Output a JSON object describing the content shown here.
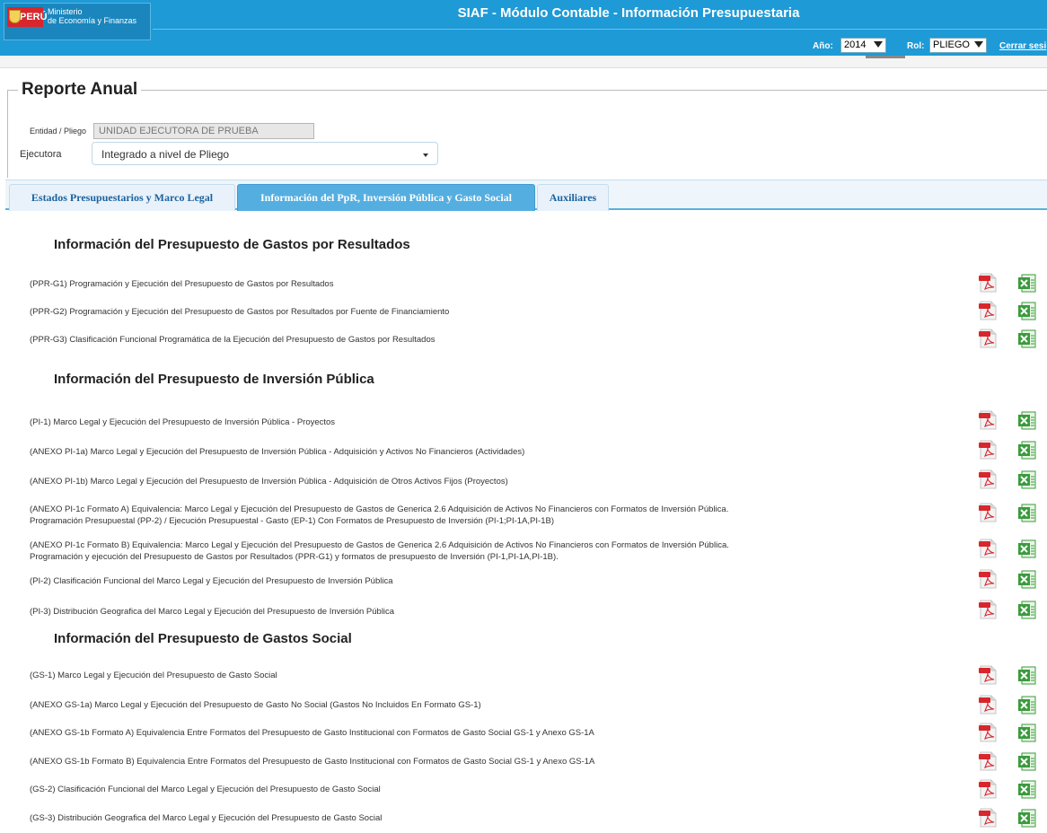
{
  "header": {
    "logo_country": "PERÚ",
    "logo_ministry_line1": "Ministerio",
    "logo_ministry_line2": "de Economía y Finanzas",
    "title": "SIAF - Módulo Contable - Información Presupuestaria",
    "year_label": "Año:",
    "year_value": "2014",
    "role_label": "Rol:",
    "role_value": "PLIEGO",
    "logout_label": "Cerrar sesi"
  },
  "report": {
    "title": "Reporte Anual",
    "entidad_label": "Entidad / Pliego",
    "entidad_value": "UNIDAD EJECUTORA DE PRUEBA",
    "ejecutora_label": "Ejecutora",
    "ejecutora_value": "Integrado a nivel de Pliego"
  },
  "tabs": [
    {
      "label": "Estados Presupuestarios y Marco Legal",
      "active": false
    },
    {
      "label": "Información del PpR, Inversión Pública y Gasto Social",
      "active": true
    },
    {
      "label": "Auxiliares",
      "active": false
    }
  ],
  "sections": [
    {
      "title": "Información del Presupuesto de Gastos por Resultados",
      "rows": [
        {
          "text": "(PPR-G1) Programación y Ejecución del Presupuesto de Gastos por Resultados"
        },
        {
          "text": "(PPR-G2) Programación y Ejecución del Presupuesto de Gastos por Resultados por Fuente de Financiamiento"
        },
        {
          "text": "(PPR-G3) Clasificación Funcional Programática de la Ejecución del Presupuesto de Gastos por Resultados"
        }
      ]
    },
    {
      "title": "Información del Presupuesto de Inversión Pública",
      "rows": [
        {
          "text": "(PI-1) Marco Legal y Ejecución del Presupuesto de Inversión Pública - Proyectos"
        },
        {
          "text": "(ANEXO PI-1a) Marco Legal y Ejecución del Presupuesto de Inversión Pública - Adquisición y Activos No Financieros (Actividades)"
        },
        {
          "text": "(ANEXO PI-1b) Marco Legal y Ejecución del Presupuesto de Inversión Pública - Adquisición de Otros Activos Fijos (Proyectos)"
        },
        {
          "text": "(ANEXO PI-1c Formato A) Equivalencia: Marco Legal y Ejecución del Presupuesto de Gastos de Generica 2.6 Adquisición de Activos No Financieros con Formatos de Inversión Pública.",
          "text2": "Programación Presupuestal (PP-2) / Ejecución Presupuestal - Gasto (EP-1) Con Formatos de Presupuesto de Inversión (PI-1;PI-1A,PI-1B)"
        },
        {
          "text": "(ANEXO PI-1c Formato B) Equivalencia: Marco Legal y Ejecución del Presupuesto de Gastos de Generica 2.6 Adquisición de Activos No Financieros con Formatos de Inversión Pública.",
          "text2": "Programación y ejecución del Presupuesto de Gastos por Resultados (PPR-G1) y formatos de presupuesto de Inversión (PI-1,PI-1A,PI-1B)."
        },
        {
          "text": "(PI-2) Clasificación Funcional del Marco Legal y Ejecución del Presupuesto de Inversión Pública"
        },
        {
          "text": "(PI-3) Distribución Geografica del Marco Legal y Ejecución del Presupuesto de Inversión Pública"
        }
      ]
    },
    {
      "title": "Información del Presupuesto de Gastos Social",
      "rows": [
        {
          "text": "(GS-1) Marco Legal y Ejecución del Presupuesto de Gasto Social"
        },
        {
          "text": "(ANEXO GS-1a) Marco Legal y Ejecución del Presupuesto de Gasto No Social (Gastos No Incluidos En Formato GS-1)"
        },
        {
          "text": "(ANEXO GS-1b Formato A) Equivalencia Entre Formatos del Presupuesto de Gasto Institucional con Formatos de Gasto Social GS-1 y Anexo GS-1A"
        },
        {
          "text": "(ANEXO GS-1b Formato B) Equivalencia Entre Formatos del Presupuesto de Gasto Institucional con Formatos de Gasto Social GS-1 y Anexo GS-1A"
        },
        {
          "text": "(GS-2) Clasificación Funcional del Marco Legal y Ejecución del Presupuesto de Gasto Social"
        },
        {
          "text": "(GS-3) Distribución Geografica del Marco Legal y Ejecución del Presupuesto de Gasto Social"
        }
      ]
    }
  ],
  "icons": {
    "pdf": "pdf-download-icon",
    "excel": "excel-download-icon",
    "pdf_color": "#d8262d",
    "excel_color": "#3a9b3c"
  }
}
